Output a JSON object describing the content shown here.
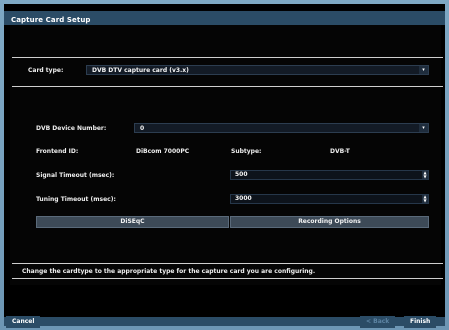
{
  "window": {
    "title": "Capture Card Setup"
  },
  "card_type": {
    "label": "Card type:",
    "value": "DVB DTV capture card (v3.x)"
  },
  "dvb_device": {
    "label": "DVB Device Number:",
    "value": "0"
  },
  "frontend": {
    "label": "Frontend ID:",
    "value": "DiBcom 7000PC"
  },
  "subtype": {
    "label": "Subtype:",
    "value": "DVB-T"
  },
  "signal_timeout": {
    "label": "Signal Timeout (msec):",
    "value": "500"
  },
  "tuning_timeout": {
    "label": "Tuning Timeout (msec):",
    "value": "3000"
  },
  "buttons": {
    "diseqc": "DiSEqC",
    "recording_options": "Recording Options",
    "cancel": "Cancel",
    "back": "< Back",
    "finish": "Finish"
  },
  "help_text": "Change the cardtype to the appropriate type for the capture card you are configuring.",
  "colors": {
    "frame": "#7ea8c4",
    "bar": "#2b4c66",
    "button": "#3d4a57",
    "disabled_text": "#5d84a3"
  },
  "icons": {
    "dropdown": "chevron-down-icon",
    "spinner": "up-down-arrows-icon"
  }
}
